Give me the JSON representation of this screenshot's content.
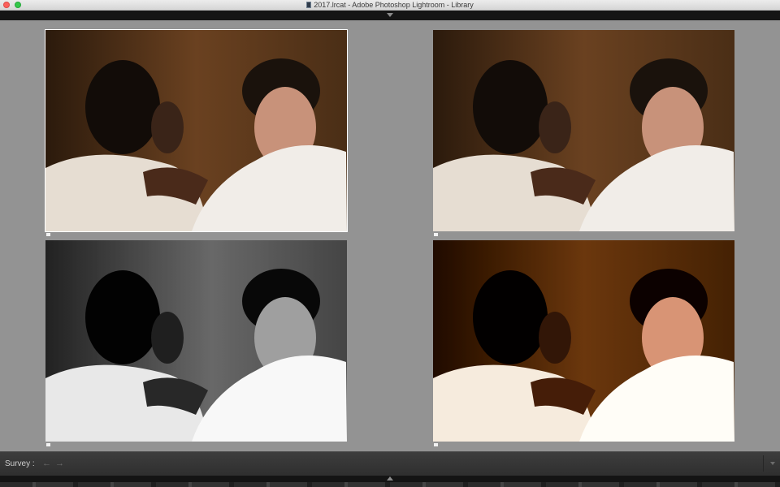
{
  "window": {
    "title": "2017.lrcat - Adobe Photoshop Lightroom - Library"
  },
  "survey": {
    "photos": [
      {
        "name": "photo-1",
        "variant": "warm-color",
        "selected": true
      },
      {
        "name": "photo-2",
        "variant": "warm-color",
        "selected": false
      },
      {
        "name": "photo-3",
        "variant": "black-and-white",
        "selected": false
      },
      {
        "name": "photo-4",
        "variant": "warm-color-high-contrast",
        "selected": false
      }
    ]
  },
  "toolbar": {
    "label": "Survey :",
    "prev_icon": "←",
    "next_icon": "→"
  },
  "colors": {
    "background": "#939393",
    "selection_border": "#ffffff"
  }
}
